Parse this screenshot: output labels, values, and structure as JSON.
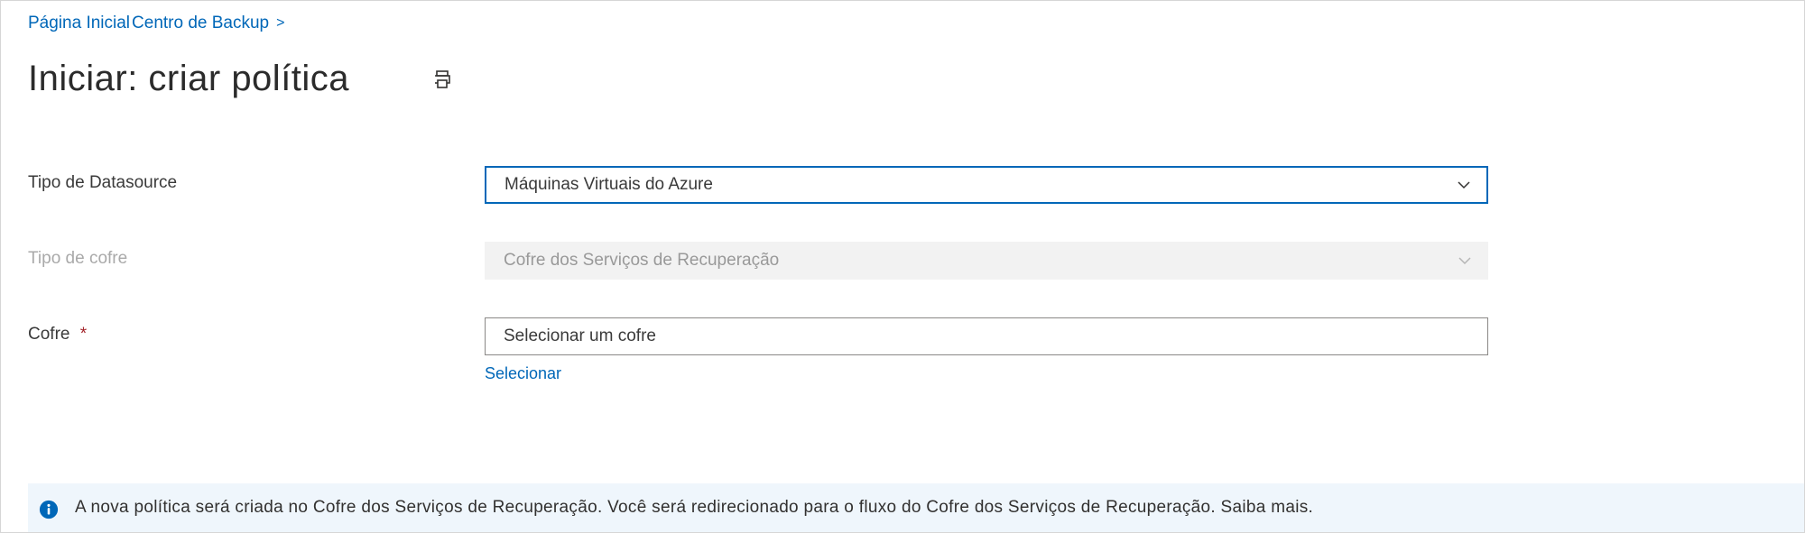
{
  "breadcrumb": {
    "home": "Página Inicial",
    "backup_center": "Centro de Backup",
    "separator": ">"
  },
  "header": {
    "title": "Iniciar: criar política"
  },
  "form": {
    "datasource_type": {
      "label": "Tipo de Datasource",
      "value": "Máquinas Virtuais do Azure"
    },
    "vault_type": {
      "label": "Tipo de cofre",
      "value": "Cofre dos Serviços de Recuperação"
    },
    "vault": {
      "label": "Cofre",
      "required_mark": "*",
      "placeholder": "Selecionar um cofre",
      "select_link": "Selecionar"
    }
  },
  "info": {
    "text": "A nova política será criada no Cofre dos Serviços de Recuperação. Você será redirecionado para o fluxo do Cofre dos Serviços de Recuperação. Saiba mais."
  }
}
